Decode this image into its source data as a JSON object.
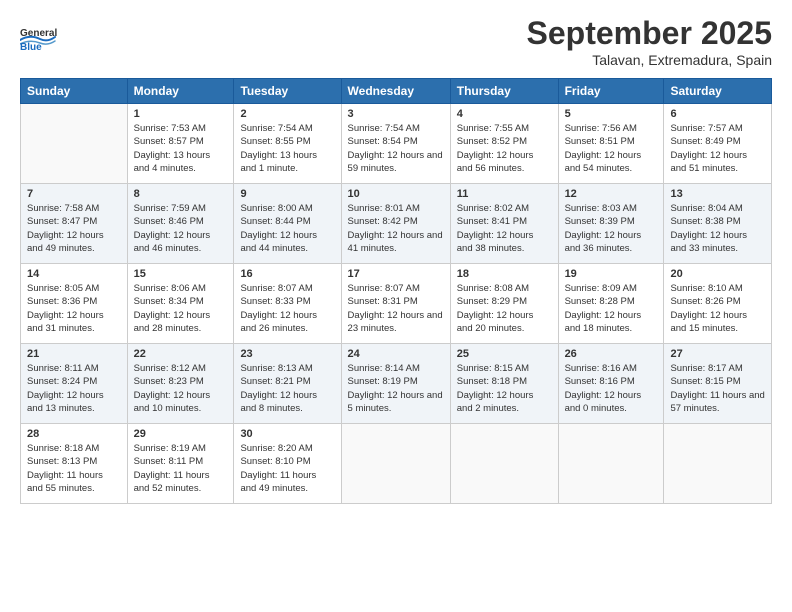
{
  "logo": {
    "general": "General",
    "blue": "Blue"
  },
  "title": "September 2025",
  "subtitle": "Talavan, Extremadura, Spain",
  "days_of_week": [
    "Sunday",
    "Monday",
    "Tuesday",
    "Wednesday",
    "Thursday",
    "Friday",
    "Saturday"
  ],
  "weeks": [
    [
      {
        "day": "",
        "sunrise": "",
        "sunset": "",
        "daylight": ""
      },
      {
        "day": "1",
        "sunrise": "Sunrise: 7:53 AM",
        "sunset": "Sunset: 8:57 PM",
        "daylight": "Daylight: 13 hours and 4 minutes."
      },
      {
        "day": "2",
        "sunrise": "Sunrise: 7:54 AM",
        "sunset": "Sunset: 8:55 PM",
        "daylight": "Daylight: 13 hours and 1 minute."
      },
      {
        "day": "3",
        "sunrise": "Sunrise: 7:54 AM",
        "sunset": "Sunset: 8:54 PM",
        "daylight": "Daylight: 12 hours and 59 minutes."
      },
      {
        "day": "4",
        "sunrise": "Sunrise: 7:55 AM",
        "sunset": "Sunset: 8:52 PM",
        "daylight": "Daylight: 12 hours and 56 minutes."
      },
      {
        "day": "5",
        "sunrise": "Sunrise: 7:56 AM",
        "sunset": "Sunset: 8:51 PM",
        "daylight": "Daylight: 12 hours and 54 minutes."
      },
      {
        "day": "6",
        "sunrise": "Sunrise: 7:57 AM",
        "sunset": "Sunset: 8:49 PM",
        "daylight": "Daylight: 12 hours and 51 minutes."
      }
    ],
    [
      {
        "day": "7",
        "sunrise": "Sunrise: 7:58 AM",
        "sunset": "Sunset: 8:47 PM",
        "daylight": "Daylight: 12 hours and 49 minutes."
      },
      {
        "day": "8",
        "sunrise": "Sunrise: 7:59 AM",
        "sunset": "Sunset: 8:46 PM",
        "daylight": "Daylight: 12 hours and 46 minutes."
      },
      {
        "day": "9",
        "sunrise": "Sunrise: 8:00 AM",
        "sunset": "Sunset: 8:44 PM",
        "daylight": "Daylight: 12 hours and 44 minutes."
      },
      {
        "day": "10",
        "sunrise": "Sunrise: 8:01 AM",
        "sunset": "Sunset: 8:42 PM",
        "daylight": "Daylight: 12 hours and 41 minutes."
      },
      {
        "day": "11",
        "sunrise": "Sunrise: 8:02 AM",
        "sunset": "Sunset: 8:41 PM",
        "daylight": "Daylight: 12 hours and 38 minutes."
      },
      {
        "day": "12",
        "sunrise": "Sunrise: 8:03 AM",
        "sunset": "Sunset: 8:39 PM",
        "daylight": "Daylight: 12 hours and 36 minutes."
      },
      {
        "day": "13",
        "sunrise": "Sunrise: 8:04 AM",
        "sunset": "Sunset: 8:38 PM",
        "daylight": "Daylight: 12 hours and 33 minutes."
      }
    ],
    [
      {
        "day": "14",
        "sunrise": "Sunrise: 8:05 AM",
        "sunset": "Sunset: 8:36 PM",
        "daylight": "Daylight: 12 hours and 31 minutes."
      },
      {
        "day": "15",
        "sunrise": "Sunrise: 8:06 AM",
        "sunset": "Sunset: 8:34 PM",
        "daylight": "Daylight: 12 hours and 28 minutes."
      },
      {
        "day": "16",
        "sunrise": "Sunrise: 8:07 AM",
        "sunset": "Sunset: 8:33 PM",
        "daylight": "Daylight: 12 hours and 26 minutes."
      },
      {
        "day": "17",
        "sunrise": "Sunrise: 8:07 AM",
        "sunset": "Sunset: 8:31 PM",
        "daylight": "Daylight: 12 hours and 23 minutes."
      },
      {
        "day": "18",
        "sunrise": "Sunrise: 8:08 AM",
        "sunset": "Sunset: 8:29 PM",
        "daylight": "Daylight: 12 hours and 20 minutes."
      },
      {
        "day": "19",
        "sunrise": "Sunrise: 8:09 AM",
        "sunset": "Sunset: 8:28 PM",
        "daylight": "Daylight: 12 hours and 18 minutes."
      },
      {
        "day": "20",
        "sunrise": "Sunrise: 8:10 AM",
        "sunset": "Sunset: 8:26 PM",
        "daylight": "Daylight: 12 hours and 15 minutes."
      }
    ],
    [
      {
        "day": "21",
        "sunrise": "Sunrise: 8:11 AM",
        "sunset": "Sunset: 8:24 PM",
        "daylight": "Daylight: 12 hours and 13 minutes."
      },
      {
        "day": "22",
        "sunrise": "Sunrise: 8:12 AM",
        "sunset": "Sunset: 8:23 PM",
        "daylight": "Daylight: 12 hours and 10 minutes."
      },
      {
        "day": "23",
        "sunrise": "Sunrise: 8:13 AM",
        "sunset": "Sunset: 8:21 PM",
        "daylight": "Daylight: 12 hours and 8 minutes."
      },
      {
        "day": "24",
        "sunrise": "Sunrise: 8:14 AM",
        "sunset": "Sunset: 8:19 PM",
        "daylight": "Daylight: 12 hours and 5 minutes."
      },
      {
        "day": "25",
        "sunrise": "Sunrise: 8:15 AM",
        "sunset": "Sunset: 8:18 PM",
        "daylight": "Daylight: 12 hours and 2 minutes."
      },
      {
        "day": "26",
        "sunrise": "Sunrise: 8:16 AM",
        "sunset": "Sunset: 8:16 PM",
        "daylight": "Daylight: 12 hours and 0 minutes."
      },
      {
        "day": "27",
        "sunrise": "Sunrise: 8:17 AM",
        "sunset": "Sunset: 8:15 PM",
        "daylight": "Daylight: 11 hours and 57 minutes."
      }
    ],
    [
      {
        "day": "28",
        "sunrise": "Sunrise: 8:18 AM",
        "sunset": "Sunset: 8:13 PM",
        "daylight": "Daylight: 11 hours and 55 minutes."
      },
      {
        "day": "29",
        "sunrise": "Sunrise: 8:19 AM",
        "sunset": "Sunset: 8:11 PM",
        "daylight": "Daylight: 11 hours and 52 minutes."
      },
      {
        "day": "30",
        "sunrise": "Sunrise: 8:20 AM",
        "sunset": "Sunset: 8:10 PM",
        "daylight": "Daylight: 11 hours and 49 minutes."
      },
      {
        "day": "",
        "sunrise": "",
        "sunset": "",
        "daylight": ""
      },
      {
        "day": "",
        "sunrise": "",
        "sunset": "",
        "daylight": ""
      },
      {
        "day": "",
        "sunrise": "",
        "sunset": "",
        "daylight": ""
      },
      {
        "day": "",
        "sunrise": "",
        "sunset": "",
        "daylight": ""
      }
    ]
  ]
}
